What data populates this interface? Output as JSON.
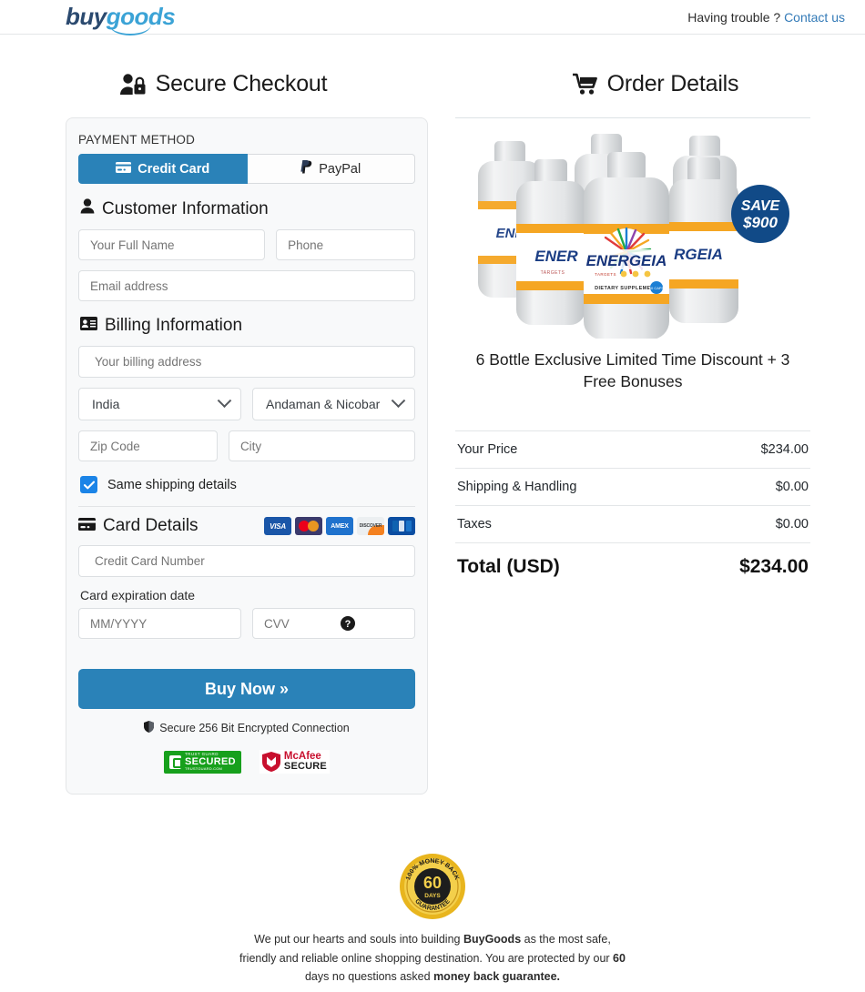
{
  "header": {
    "logo_buy": "buy",
    "logo_goods": "goods",
    "help_text": "Having trouble ?",
    "contact_link": "Contact us"
  },
  "checkout": {
    "title": "Secure Checkout",
    "payment_method_label": "PAYMENT METHOD",
    "tabs": [
      {
        "label": "Credit Card",
        "icon": "credit-card-icon",
        "active": true
      },
      {
        "label": "PayPal",
        "icon": "paypal-icon",
        "active": false
      }
    ],
    "customer_section": {
      "title": "Customer Information",
      "fields": [
        {
          "name": "full-name",
          "placeholder": "Your Full Name",
          "value": ""
        },
        {
          "name": "phone",
          "placeholder": "Phone",
          "value": ""
        },
        {
          "name": "email",
          "placeholder": "Email address",
          "value": ""
        }
      ]
    },
    "billing_section": {
      "title": "Billing Information",
      "address_placeholder": "Your billing address",
      "country_value": "India",
      "state_value": "Andaman & Nicobar",
      "zip_placeholder": "Zip Code",
      "city_placeholder": "City",
      "same_shipping_label": "Same shipping details",
      "same_shipping_checked": true
    },
    "card_section": {
      "title": "Card Details",
      "accepted_cards": [
        "VISA",
        "Mastercard",
        "AMEX",
        "DISCOVER",
        "JCB"
      ],
      "card_number_placeholder": "Credit Card Number",
      "expiration_label": "Card expiration date",
      "expiration_placeholder": "MM/YYYY",
      "cvv_placeholder": "CVV",
      "cvv_help_icon": "question-circle-icon"
    },
    "buy_button": "Buy Now »",
    "secure_note": "Secure 256 Bit Encrypted Connection",
    "trust_badges": [
      {
        "name": "trust-guard",
        "top": "TRUST GUARD",
        "main": "SECURED",
        "bottom": "TRUSTGUARD.COM"
      },
      {
        "name": "mcafee",
        "main": "McAfee",
        "sub": "SECURE"
      }
    ]
  },
  "order": {
    "title": "Order Details",
    "product": {
      "brand": "ENERGEIA",
      "sub1": "TARGETS",
      "sub2": "DIETARY SUPPLEMENT",
      "capsules": "60 CAPS",
      "save_badge_line1": "SAVE",
      "save_badge_line2": "$900",
      "name": "6 Bottle Exclusive Limited Time Discount + 3 Free Bonuses"
    },
    "lines": [
      {
        "label": "Your Price",
        "value": "$234.00"
      },
      {
        "label": "Shipping & Handling",
        "value": "$0.00"
      },
      {
        "label": "Taxes",
        "value": "$0.00"
      }
    ],
    "total_label": "Total (USD)",
    "total_value": "$234.00"
  },
  "footer": {
    "guarantee_badge": {
      "top": "100% MONEY BACK",
      "days": "60",
      "days_label": "DAYS",
      "bottom": "GUARANTEE"
    },
    "text_1": "We put our hearts and souls into building ",
    "text_b1": "BuyGoods",
    "text_2": " as the most safe, friendly and reliable online shopping destination. You are protected by our ",
    "text_b2": "60",
    "text_3": " days no questions asked ",
    "text_b3": "money back guarantee."
  },
  "colors": {
    "accent_blue": "#2a82b8",
    "link_blue": "#337ab7",
    "checkbox_blue": "#1b84e7",
    "panel_bg": "#f8f9fa",
    "badge_navy": "#114a87"
  }
}
